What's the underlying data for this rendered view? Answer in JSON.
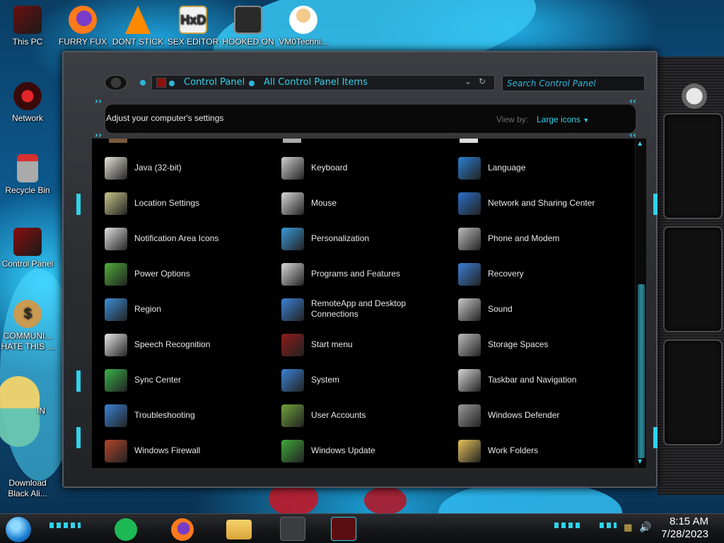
{
  "desktop": {
    "icons": [
      {
        "label": "This PC",
        "icon": "computer-icon"
      },
      {
        "label": "FURRY FUX",
        "icon": "firefox-icon"
      },
      {
        "label": "DONT STICK",
        "icon": "vlc-icon"
      },
      {
        "label": "SEX EDITOR",
        "icon": "hxd-icon"
      },
      {
        "label": "HOOKED ON",
        "icon": "game-icon"
      },
      {
        "label": "VM0Techni...",
        "icon": "doctor-icon"
      },
      {
        "label": "Network",
        "icon": "network-icon"
      },
      {
        "label": "Recycle Bin",
        "icon": "recycle-bin-icon"
      },
      {
        "label": "Control Panel",
        "icon": "control-panel-icon"
      },
      {
        "label_line1": "COMMUNI...",
        "label_line2": "HATE THIS ...",
        "icon": "money-bag-icon"
      },
      {
        "label": "IN",
        "icon": "cartoon-icon"
      },
      {
        "label_line1": "Download",
        "label_line2": "Black Ali...",
        "icon": "download-icon"
      }
    ]
  },
  "window": {
    "breadcrumb": [
      "Control Panel",
      "All Control Panel Items"
    ],
    "search_placeholder": "Search Control Panel",
    "header_title": "Adjust your computer's settings",
    "view_by_label": "View by:",
    "view_by_value": "Large icons",
    "items": [
      {
        "label": "Java (32-bit)",
        "icon": "java-icon",
        "color": "#e8e4d8"
      },
      {
        "label": "Keyboard",
        "icon": "keyboard-icon",
        "color": "#cfcfcf"
      },
      {
        "label": "Language",
        "icon": "globe-icon",
        "color": "#2a7fd1"
      },
      {
        "label": "Location Settings",
        "icon": "location-icon",
        "color": "#c8c58a"
      },
      {
        "label": "Mouse",
        "icon": "mouse-icon",
        "color": "#d8d8d8"
      },
      {
        "label": "Network and Sharing Center",
        "icon": "network-sharing-icon",
        "color": "#2b6ec8"
      },
      {
        "label": "Notification Area Icons",
        "icon": "notification-icon",
        "color": "#e0e0e0"
      },
      {
        "label": "Personalization",
        "icon": "personalization-icon",
        "color": "#3a9ad9"
      },
      {
        "label": "Phone and Modem",
        "icon": "phone-icon",
        "color": "#bdbdbd"
      },
      {
        "label": "Power Options",
        "icon": "battery-icon",
        "color": "#4fae3a"
      },
      {
        "label": "Programs and Features",
        "icon": "programs-icon",
        "color": "#d9d9d9"
      },
      {
        "label": "Recovery",
        "icon": "recovery-icon",
        "color": "#3b7fd4"
      },
      {
        "label": "Region",
        "icon": "region-icon",
        "color": "#3c8fd8"
      },
      {
        "label_line1": "RemoteApp and Desktop",
        "label_line2": "Connections",
        "icon": "remote-desktop-icon",
        "color": "#3b82d6"
      },
      {
        "label": "Sound",
        "icon": "speaker-icon",
        "color": "#c9c9c9"
      },
      {
        "label": "Speech Recognition",
        "icon": "microphone-icon",
        "color": "#e6e6e6"
      },
      {
        "label": "Start menu",
        "icon": "start-menu-icon",
        "color": "#8e1b1b"
      },
      {
        "label": "Storage Spaces",
        "icon": "storage-icon",
        "color": "#bdbdbd"
      },
      {
        "label": "Sync Center",
        "icon": "sync-icon",
        "color": "#38b24a"
      },
      {
        "label": "System",
        "icon": "system-icon",
        "color": "#3b82d6"
      },
      {
        "label": "Taskbar and Navigation",
        "icon": "taskbar-icon",
        "color": "#d6d6d6"
      },
      {
        "label": "Troubleshooting",
        "icon": "troubleshooting-icon",
        "color": "#3b82d6"
      },
      {
        "label": "User Accounts",
        "icon": "users-icon",
        "color": "#6fa33a"
      },
      {
        "label": "Windows Defender",
        "icon": "wall-icon",
        "color": "#9a9a9a"
      },
      {
        "label": "Windows Firewall",
        "icon": "firewall-icon",
        "color": "#b2452a"
      },
      {
        "label": "Windows Update",
        "icon": "update-icon",
        "color": "#3fa83a"
      },
      {
        "label": "Work Folders",
        "icon": "folder-icon",
        "color": "#e8c45a"
      }
    ]
  },
  "taskbar": {
    "time": "8:15 AM",
    "date": "7/28/2023"
  },
  "colors": {
    "accent": "#2fd2ea",
    "alert": "#e0262a"
  }
}
